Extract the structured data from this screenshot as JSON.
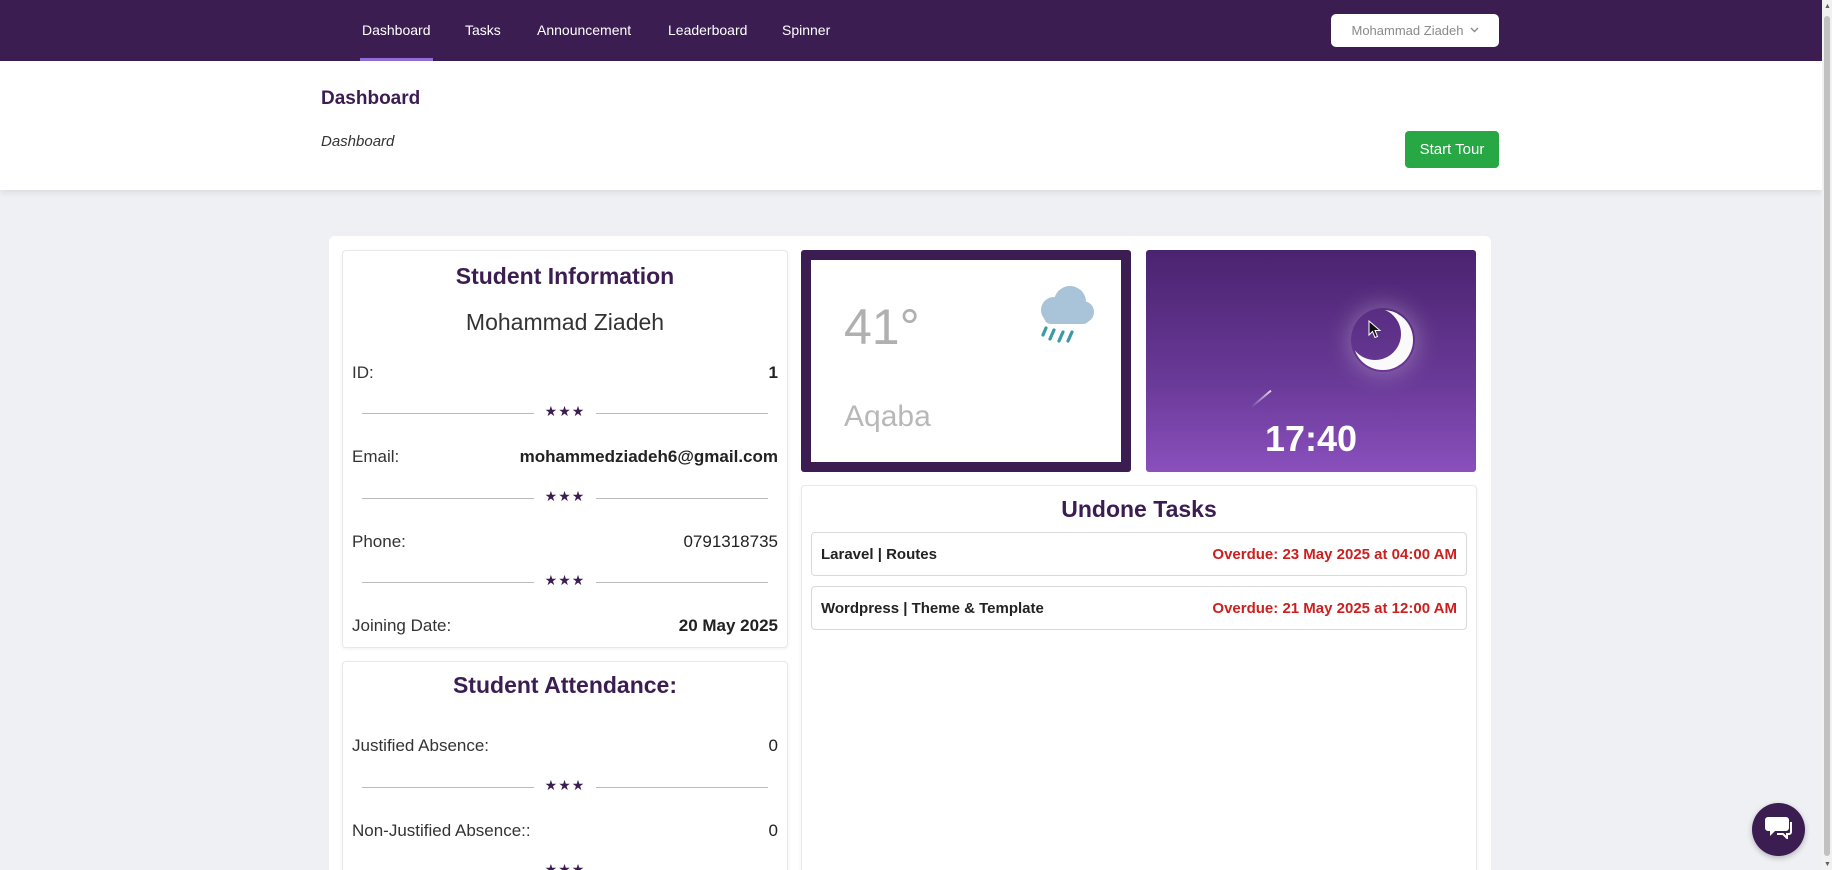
{
  "nav": {
    "links": [
      {
        "label": "Dashboard"
      },
      {
        "label": "Tasks"
      },
      {
        "label": "Announcement"
      },
      {
        "label": "Leaderboard"
      },
      {
        "label": "Spinner"
      }
    ],
    "active": "Dashboard",
    "user_menu_label": "Mohammad Ziadeh"
  },
  "header": {
    "title": "Dashboard",
    "breadcrumb": "Dashboard",
    "tour_button_label": "Start Tour"
  },
  "student_info": {
    "title": "Student Information",
    "name": "Mohammad Ziadeh",
    "rows": [
      {
        "label": "ID:",
        "value": "1"
      },
      {
        "label": "Email:",
        "value": "mohammedziadeh6@gmail.com"
      },
      {
        "label": "Phone:",
        "value": "0791318735"
      },
      {
        "label": "Joining Date:",
        "value": "20 May 2025"
      }
    ],
    "divider_symbol": "★★★"
  },
  "attendance": {
    "title": "Student Attendance:",
    "rows": [
      {
        "label": "Justified Absence:",
        "value": "0"
      },
      {
        "label": "Non-Justified Absence::",
        "value": "0"
      }
    ]
  },
  "weather": {
    "temperature": "41°",
    "city": "Aqaba",
    "icon": "rain-cloud-icon"
  },
  "clock": {
    "time": "17:40",
    "icon": "moon-icon"
  },
  "undone_tasks": {
    "title": "Undone Tasks",
    "items": [
      {
        "name": "Laravel | Routes",
        "due": "Overdue: 23 May 2025 at 04:00 AM"
      },
      {
        "name": "Wordpress | Theme & Template",
        "due": "Overdue: 21 May 2025 at 12:00 AM"
      }
    ]
  },
  "colors": {
    "primary": "#3b1d52",
    "success": "#28a745",
    "danger": "#cc1f1f"
  }
}
